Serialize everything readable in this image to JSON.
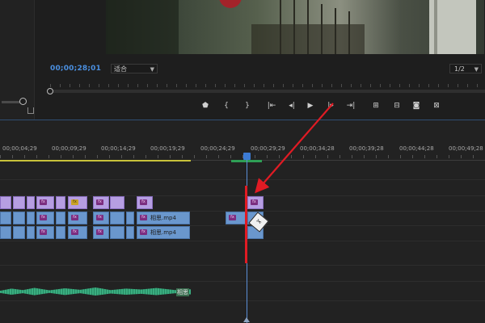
{
  "monitor": {
    "timecode": "00;00;28;01",
    "fit_value": "适合",
    "resolution_value": "1/2"
  },
  "transport": {
    "icons": [
      "marker-icon",
      "mark-in-icon",
      "mark-out-icon",
      "go-to-in-icon",
      "step-back-icon",
      "play-icon",
      "step-forward-icon",
      "go-to-out-icon",
      "insert-icon",
      "overwrite-icon",
      "export-frame-icon",
      "comparison-view-icon"
    ],
    "glyphs": [
      "⬟",
      "{",
      "}",
      "|⇤",
      "◂|",
      "▶",
      "|▸",
      "⇥|",
      "⊞",
      "⊟",
      "◙",
      "⊠"
    ]
  },
  "ruler": {
    "labels": [
      "00;00;04;29",
      "00;00;09;29",
      "00;00;14;29",
      "00;00;19;29",
      "00;00;24;29",
      "00;00;29;29",
      "00;00;34;28",
      "00;00;39;28",
      "00;00;44;28",
      "00;00;49;28"
    ]
  },
  "clips": {
    "fx_label": "fx",
    "video_label": "相思.mp4",
    "audio_label": "相思"
  },
  "colors": {
    "timecode": "#4a8fe0",
    "video_clip": "#b69ee2",
    "linked_clip": "#6a97cd",
    "audio_clip": "#2f9b72",
    "playhead": "#5b8fd6",
    "annotation_red": "#e01b24"
  }
}
